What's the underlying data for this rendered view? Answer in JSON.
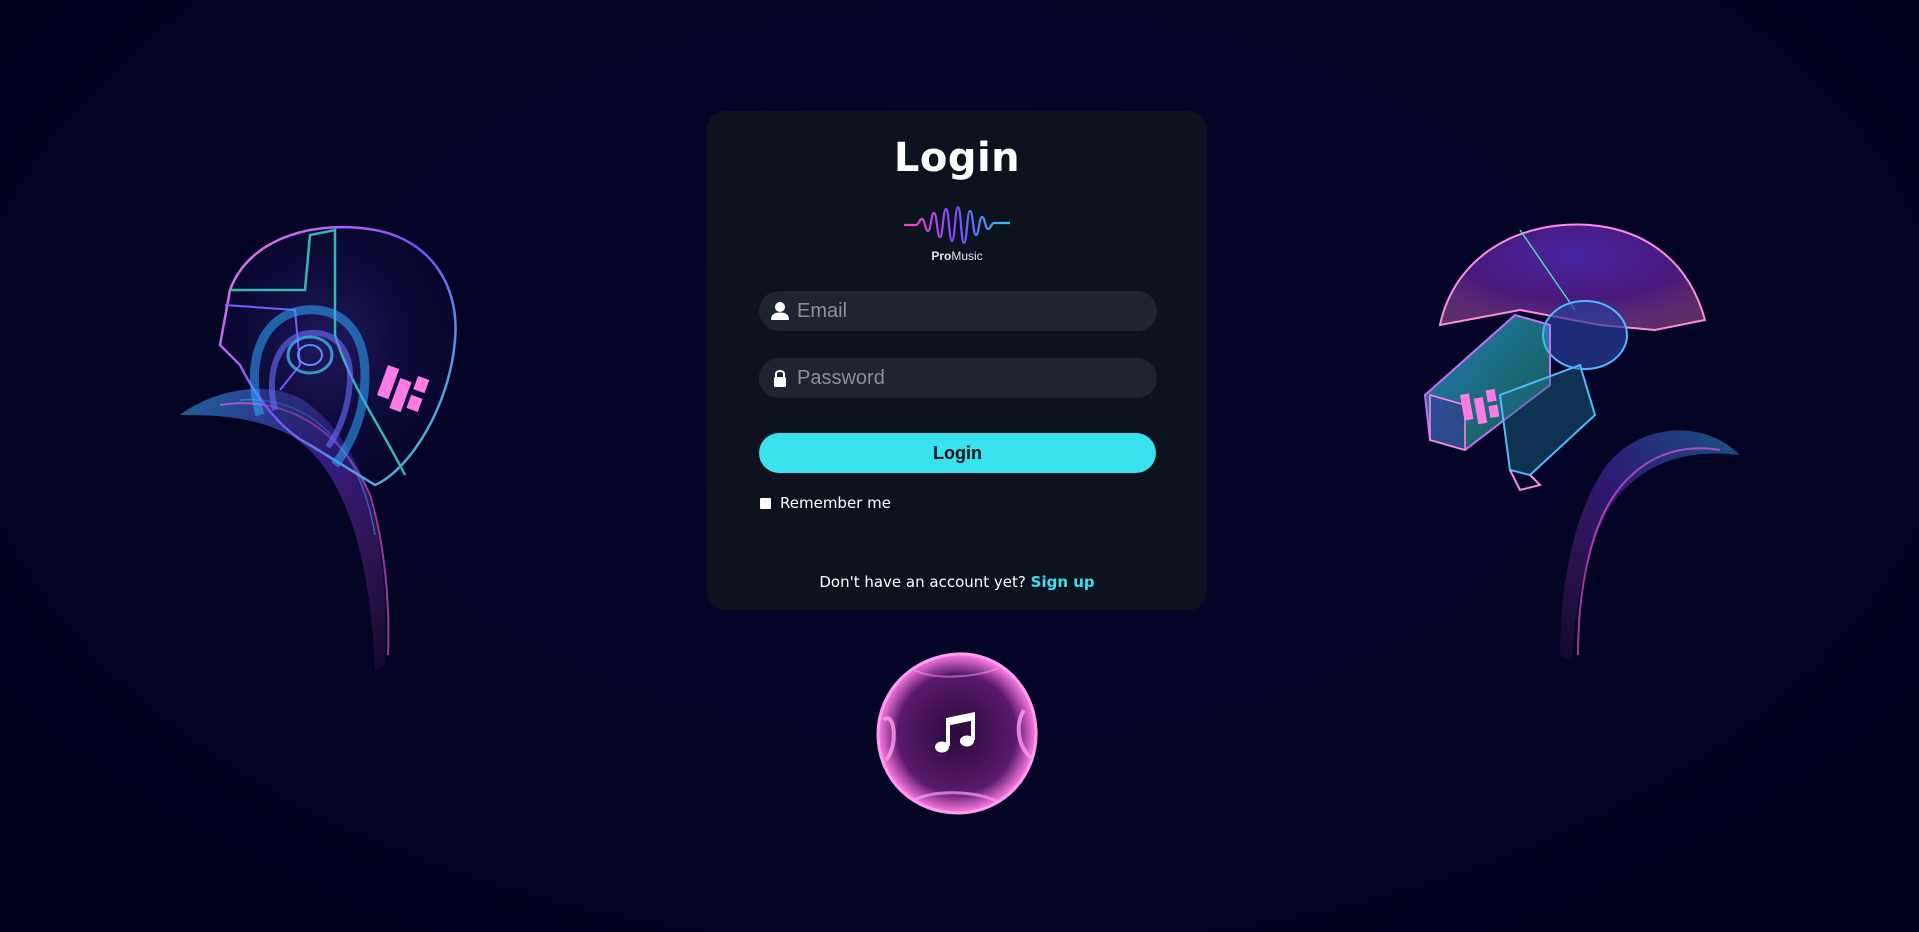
{
  "login": {
    "title": "Login",
    "logo": {
      "text_bold": "Pro",
      "text_regular": "Music",
      "icon": "sound-wave-logo-icon"
    },
    "email": {
      "icon": "user-icon",
      "value": "",
      "placeholder": "Email"
    },
    "password": {
      "icon": "lock-icon",
      "value": "",
      "placeholder": "Password"
    },
    "submit_label": "Login",
    "remember": {
      "label": "Remember me",
      "checked": false
    },
    "signup": {
      "prompt": "Don't have an account yet?",
      "link_label": "Sign up"
    }
  },
  "decor": {
    "left_figure": "helmet-left-illustration",
    "right_figure": "helmet-right-illustration",
    "orb_icon": "music-note-icon"
  },
  "colors": {
    "background": "#030323",
    "card": "#0c131e",
    "field": "#1e2430",
    "accent": "#38e1ec",
    "neon_pink": "#ff7ce6",
    "neon_purple": "#7a4cff",
    "neon_blue": "#2fa8ff"
  }
}
